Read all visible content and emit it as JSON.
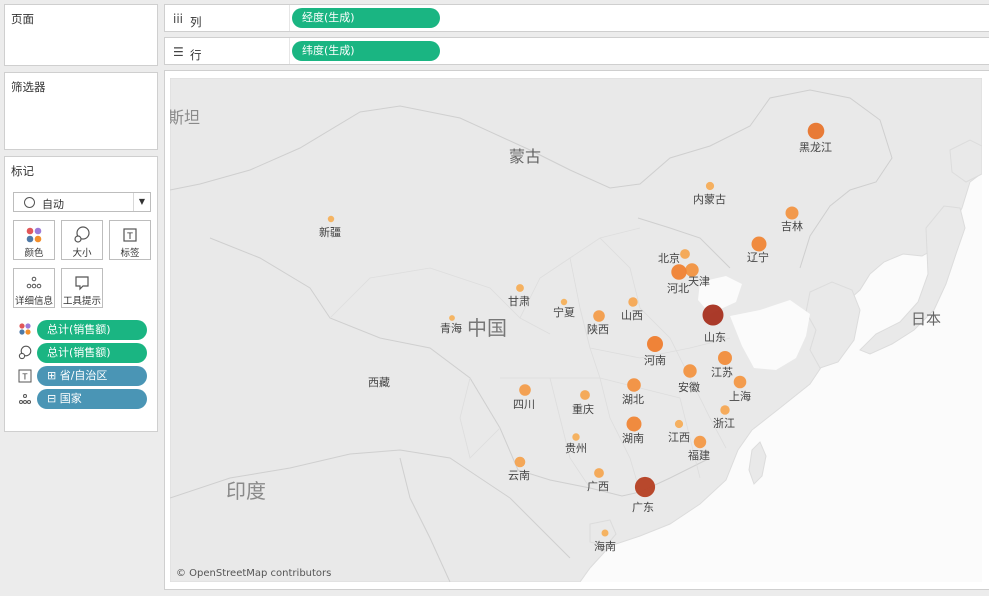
{
  "pages": {
    "title": "页面"
  },
  "filters": {
    "title": "筛选器"
  },
  "marks": {
    "title": "标记",
    "mark_type": "自动",
    "buttons": {
      "color": "颜色",
      "size": "大小",
      "label": "标签",
      "detail": "详细信息",
      "tooltip": "工具提示"
    },
    "fields": [
      {
        "icon": "color-icon",
        "label": "总计(销售额)"
      },
      {
        "icon": "size-icon",
        "label": "总计(销售额)"
      },
      {
        "icon": "label-icon",
        "label": "⊞ 省/自治区"
      },
      {
        "icon": "detail-icon",
        "label": "⊟ 国家"
      }
    ]
  },
  "shelves": {
    "columns": {
      "label": "列",
      "pill": "经度(生成)"
    },
    "rows": {
      "label": "行",
      "pill": "纬度(生成)"
    }
  },
  "map": {
    "attribution": "© OpenStreetMap contributors",
    "country_labels": {
      "china": "中国",
      "mongolia": "蒙古",
      "india": "印度",
      "japan": "日本",
      "kazakhstan_fragment": "斯坦"
    },
    "provinces": [
      {
        "name": "黑龙江",
        "sales_level": 0.55
      },
      {
        "name": "内蒙古",
        "sales_level": 0.06
      },
      {
        "name": "吉林",
        "sales_level": 0.28
      },
      {
        "name": "辽宁",
        "sales_level": 0.42
      },
      {
        "name": "北京",
        "sales_level": 0.12
      },
      {
        "name": "天津",
        "sales_level": 0.3
      },
      {
        "name": "河北",
        "sales_level": 0.45
      },
      {
        "name": "新疆",
        "sales_level": 0.02
      },
      {
        "name": "甘肃",
        "sales_level": 0.05
      },
      {
        "name": "宁夏",
        "sales_level": 0.02
      },
      {
        "name": "青海",
        "sales_level": 0.01
      },
      {
        "name": "陕西",
        "sales_level": 0.2
      },
      {
        "name": "山西",
        "sales_level": 0.1
      },
      {
        "name": "山东",
        "sales_level": 1.0
      },
      {
        "name": "河南",
        "sales_level": 0.5
      },
      {
        "name": "江苏",
        "sales_level": 0.35
      },
      {
        "name": "安徽",
        "sales_level": 0.3
      },
      {
        "name": "上海",
        "sales_level": 0.25
      },
      {
        "name": "湖北",
        "sales_level": 0.32
      },
      {
        "name": "四川",
        "sales_level": 0.2
      },
      {
        "name": "重庆",
        "sales_level": 0.12
      },
      {
        "name": "西藏",
        "sales_level": 0.0
      },
      {
        "name": "浙江",
        "sales_level": 0.1
      },
      {
        "name": "湖南",
        "sales_level": 0.42
      },
      {
        "name": "贵州",
        "sales_level": 0.04
      },
      {
        "name": "江西",
        "sales_level": 0.06
      },
      {
        "name": "福建",
        "sales_level": 0.24
      },
      {
        "name": "云南",
        "sales_level": 0.15
      },
      {
        "name": "广西",
        "sales_level": 0.12
      },
      {
        "name": "广东",
        "sales_level": 0.9
      },
      {
        "name": "海南",
        "sales_level": 0.03
      }
    ],
    "colors": {
      "low": "#f6b35e",
      "mid": "#ef7d2e",
      "high": "#a6301f",
      "land": "#e9e9e9",
      "sea": "#fbfbfb",
      "border": "#d3d3d3"
    }
  }
}
